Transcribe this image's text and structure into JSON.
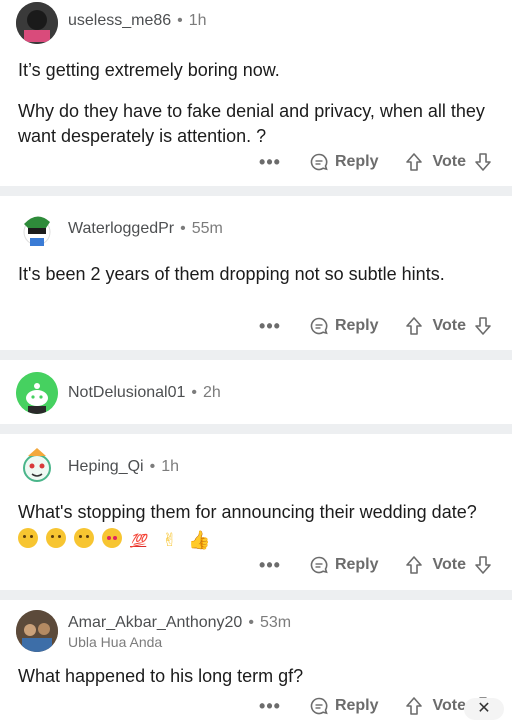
{
  "comments": [
    {
      "username": "useless_me86",
      "time": "1h",
      "body": [
        "It’s getting extremely boring now.",
        "Why do they have to fake denial and privacy, when all they want desperately is attention. ?"
      ],
      "reply_label": "Reply",
      "vote_label": "Vote"
    },
    {
      "username": "WaterloggedPr",
      "time": "55m",
      "body": [
        "It's been 2 years of them dropping not so subtle hints."
      ],
      "reply_label": "Reply",
      "vote_label": "Vote"
    },
    {
      "username": "NotDelusional01",
      "time": "2h"
    },
    {
      "username": "Heping_Qi",
      "time": "1h",
      "body": [
        "What's stopping them for announcing their wedding date?"
      ],
      "emoji_text": "💯",
      "reply_label": "Reply",
      "vote_label": "Vote"
    },
    {
      "username": "Amar_Akbar_Anthony20",
      "time": "53m",
      "flair": "Ubla Hua Anda",
      "body": [
        "What happened to his long term gf?"
      ],
      "reply_label": "Reply",
      "vote_label": "Vote"
    }
  ],
  "more_label": "•••",
  "dot": "•",
  "close_label": "✕",
  "colors": {
    "separator": "#edeff1",
    "text": "#1c1c1c",
    "muted": "#7c7c7c",
    "action": "#6c6c6c"
  },
  "icons": [
    "reply-icon",
    "upvote-icon",
    "downvote-icon",
    "more-options-icon"
  ]
}
